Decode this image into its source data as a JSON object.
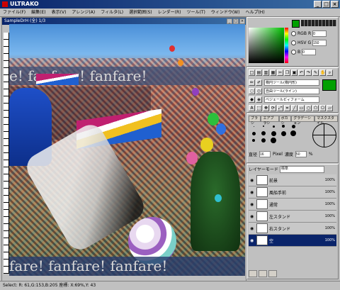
{
  "window": {
    "title": "ULTRAKO"
  },
  "menu": [
    "ファイル(F)",
    "編集(E)",
    "表示(V)",
    "アレンジ(A)",
    "フィルタ(L)",
    "選択範囲(S)",
    "レンダー(R)",
    "ツール(T)",
    "ウィンドウ(W)",
    "ヘルプ(H)"
  ],
  "document": {
    "title": "SampleDrH (全) 1/3"
  },
  "canvas_text": {
    "banner_top": "e! fanfare! fanfare!",
    "banner_bottom": "fare! fanfare! fanfare!"
  },
  "color_panel": {
    "modes": [
      {
        "label": "RGB",
        "channel": "R",
        "value": "0"
      },
      {
        "label": "HSV",
        "channel": "G",
        "value": "150"
      },
      {
        "label": "",
        "channel": "B",
        "value": "0"
      }
    ],
    "fg_color": "#00a000"
  },
  "tools": {
    "combo1": "楕円ツール(楕円形)",
    "combo2": "自由ツール(ライン)",
    "combo3": "ベジェールビィフォーム"
  },
  "brush": {
    "tabs": [
      "ブラシ",
      "エアブラシ",
      "ボカシ",
      "グラデーション",
      "マスクスタイル"
    ],
    "size_label": "直径",
    "size_value": "16",
    "size_unit": "Pixel",
    "density_label": "濃度",
    "density_value": "50",
    "density_unit": "%"
  },
  "layers": {
    "mode_label": "レイヤーモード",
    "mode_value": "標準",
    "items": [
      {
        "name": "前景",
        "opacity": "100%"
      },
      {
        "name": "風船手前",
        "opacity": "100%"
      },
      {
        "name": "通常",
        "opacity": "100%"
      },
      {
        "name": "左スタンド",
        "opacity": "100%"
      },
      {
        "name": "右スタンド",
        "opacity": "100%"
      },
      {
        "name": "空",
        "opacity": "100%"
      }
    ]
  },
  "status": {
    "text": "Select: R: 61,G:153,B:205   座標: X:69%,Y: 43"
  }
}
